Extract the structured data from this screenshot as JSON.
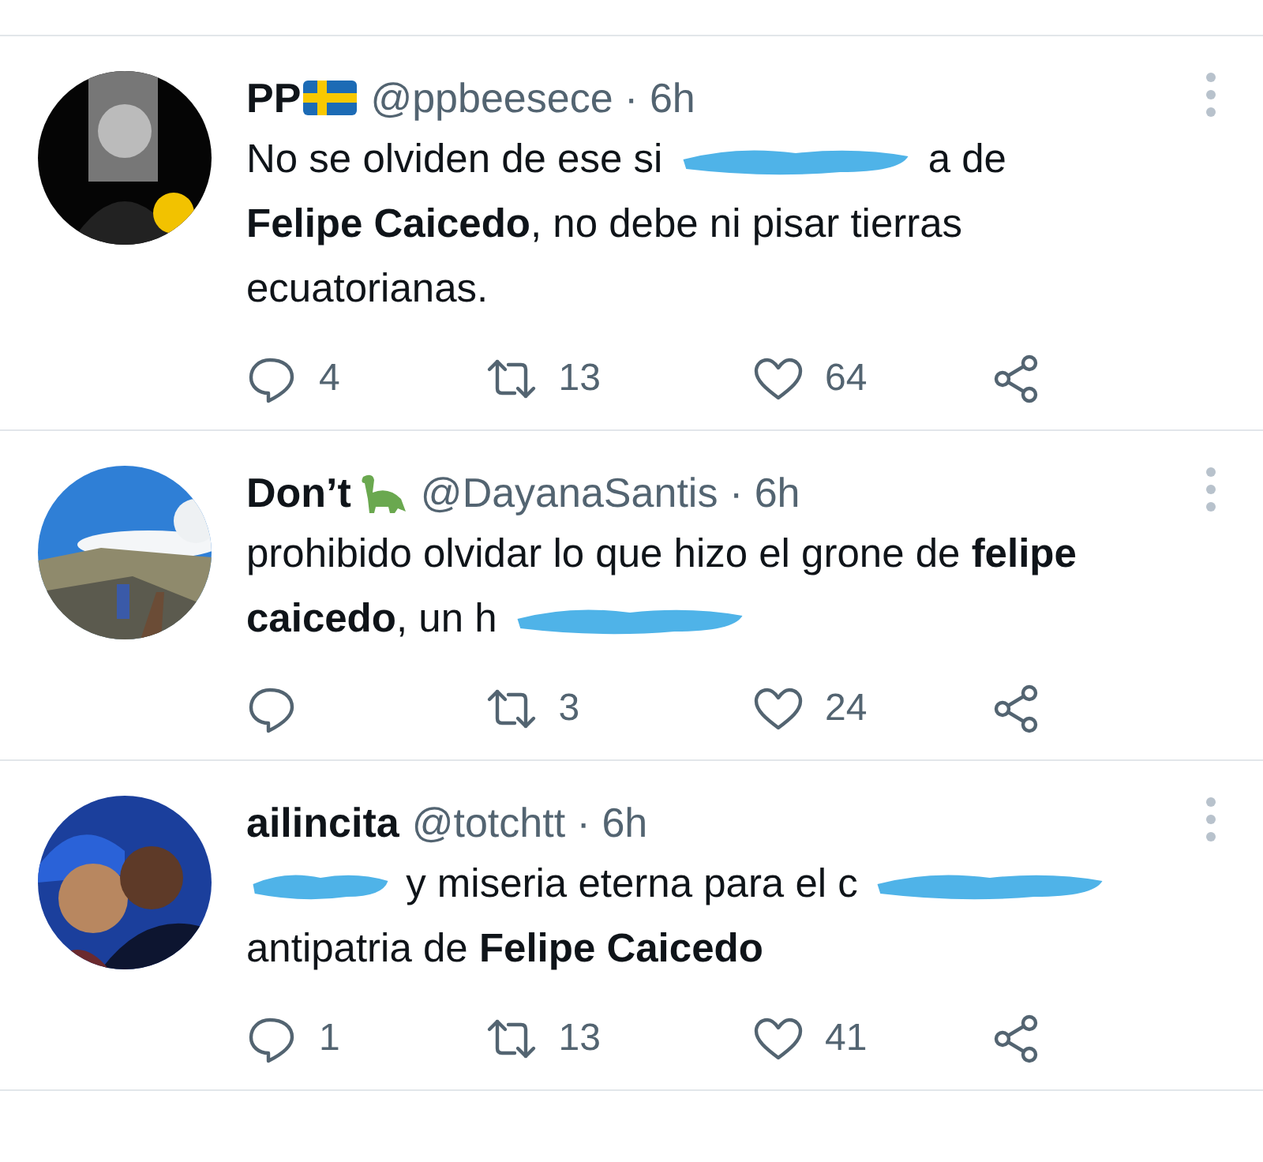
{
  "tweets": [
    {
      "avatar": {
        "kind": "picture"
      },
      "name": "PP",
      "has_badge": true,
      "handle": "@ppbeesece",
      "separator": "·",
      "time": "6h",
      "body": [
        {
          "kind": "text",
          "text": "No se olviden de ese si"
        },
        {
          "kind": "scribble"
        },
        {
          "kind": "text",
          "text": "a de"
        },
        {
          "kind": "text",
          "text": "**Felipe Caicedo**, no debe ni pisar tierras ecuatorianas."
        }
      ],
      "replies": "4",
      "retweets": "13",
      "likes": "64"
    },
    {
      "avatar": {
        "kind": "picture"
      },
      "name": "Don’t",
      "has_badge": true,
      "handle": "@DayanaSantis",
      "separator": "·",
      "time": "6h",
      "body": [
        {
          "kind": "text",
          "text": "prohibido olvidar lo que hizo el grone de **felipe**"
        },
        {
          "kind": "text",
          "text": "**caicedo**, un h"
        },
        {
          "kind": "scribble"
        }
      ],
      "retweets": "3",
      "likes": "24"
    },
    {
      "avatar": {
        "kind": "picture"
      },
      "name": "ailincita",
      "has_badge": false,
      "handle": "@totchtt",
      "separator": "·",
      "time": "6h",
      "body": [
        {
          "kind": "scribble"
        },
        {
          "kind": "text",
          "text": "y miseria eterna para el c"
        },
        {
          "kind": "scribble"
        },
        {
          "kind": "text",
          "text": "antipatria de **Felipe Caicedo**"
        }
      ],
      "replies": "1",
      "retweets": "13",
      "likes": "41"
    }
  ]
}
